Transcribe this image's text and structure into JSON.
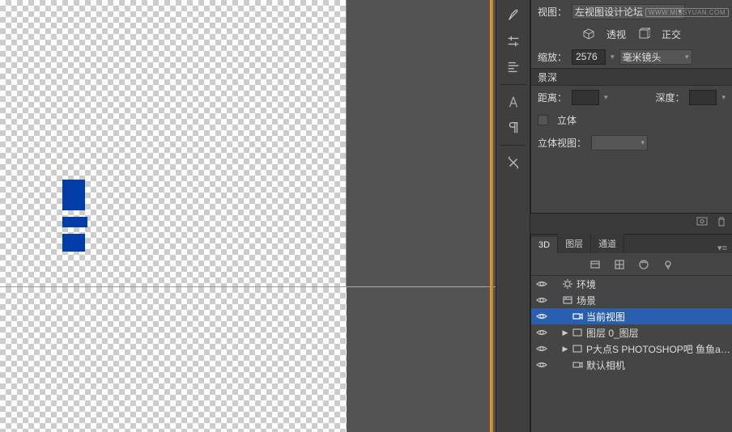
{
  "canvas": {
    "shapes": {
      "color": "#003da6"
    }
  },
  "props": {
    "view_label": "视图：",
    "view_value": "左视图设计论坛",
    "perspective_label": "透视",
    "orthographic_label": "正交",
    "zoom_label": "缩放：",
    "zoom_value": "2576",
    "lens_dropdown": "毫米镜头",
    "dof_header": "景深",
    "distance_label": "距离：",
    "distance_value": "",
    "depth_label": "深度：",
    "depth_value": "",
    "stereo_label": "立体",
    "stereo_view_label": "立体视图：",
    "stereo_view_value": ""
  },
  "tabs": {
    "t3d": "3D",
    "layers": "图层",
    "channels": "通道"
  },
  "tree": {
    "items": [
      {
        "label": "环境",
        "icon": "env",
        "indent": 0
      },
      {
        "label": "场景",
        "icon": "scene",
        "indent": 0
      },
      {
        "label": "当前视图",
        "icon": "camera",
        "indent": 2,
        "selected": true
      },
      {
        "label": "图层 0_图层",
        "icon": "layer",
        "indent": 1,
        "twisty": true
      },
      {
        "label": "P大点S PHOTOSHOP吧 鱼鱼an...",
        "icon": "layer",
        "indent": 1,
        "twisty": true
      },
      {
        "label": "默认相机",
        "icon": "camera",
        "indent": 2
      }
    ]
  },
  "watermark": "WWW.MISSYUAN.COM"
}
